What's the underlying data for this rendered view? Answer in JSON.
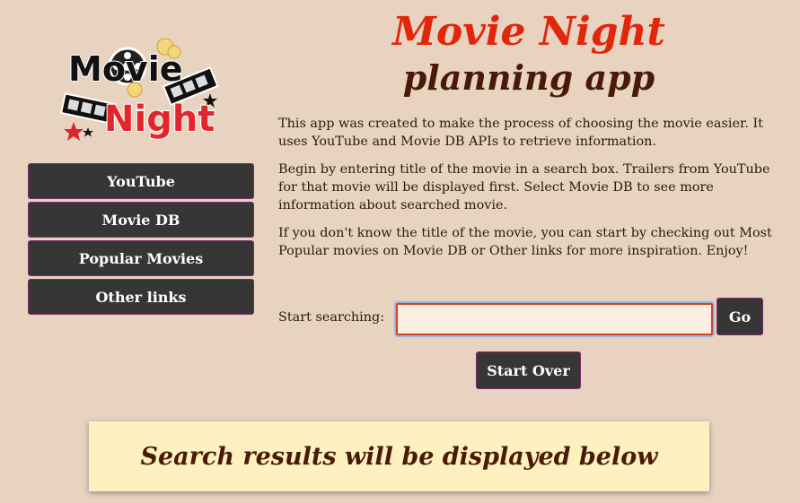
{
  "logo": {
    "word1": "Movie",
    "word2": "Night"
  },
  "header": {
    "title": "Movie Night",
    "subtitle": "planning app"
  },
  "nav": {
    "items": [
      {
        "label": "YouTube"
      },
      {
        "label": "Movie DB"
      },
      {
        "label": "Popular Movies"
      },
      {
        "label": "Other links"
      }
    ]
  },
  "description": {
    "p1": "This app was created to make the process of choosing the movie easier. It uses YouTube and Movie DB APIs to retrieve information.",
    "p2": "Begin by entering title of the movie in a search box. Trailers from YouTube for that movie will be displayed first. Select Movie DB to see more information about searched movie.",
    "p3": "If you don't know the title of the movie, you can start by checking out Most Popular movies on Movie DB or Other links for more inspiration. Enjoy!"
  },
  "search": {
    "label": "Start searching:",
    "value": "",
    "placeholder": "",
    "go_label": "Go"
  },
  "start_over_label": "Start Over",
  "results": {
    "heading": "Search results will be displayed below"
  },
  "colors": {
    "background": "#e8d3c0",
    "button": "#373636",
    "title_red": "#e2260b",
    "title_brown": "#4a1a08",
    "banner": "#fff0c0"
  }
}
